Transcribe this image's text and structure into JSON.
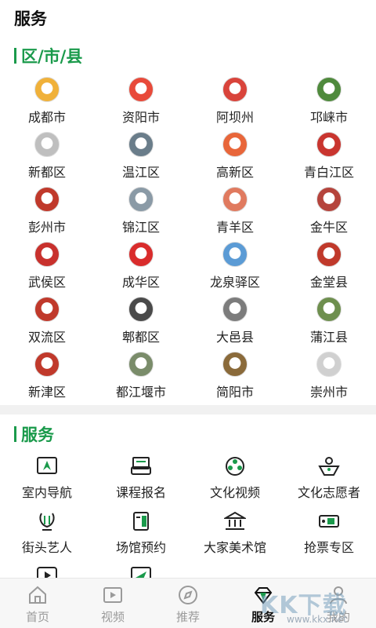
{
  "header": {
    "title": "服务"
  },
  "districts": {
    "heading": "区/市/县",
    "items": [
      {
        "label": "成都市",
        "color": "#f0b13a",
        "icon": "chengdu-emblem-icon"
      },
      {
        "label": "资阳市",
        "color": "#e84a3a",
        "icon": "ziyang-emblem-icon"
      },
      {
        "label": "阿坝州",
        "color": "#d9443b",
        "icon": "aba-emblem-icon"
      },
      {
        "label": "邛崃市",
        "color": "#4f8a3c",
        "icon": "qionglai-emblem-icon"
      },
      {
        "label": "新都区",
        "color": "#bfbfbf",
        "icon": "xindu-emblem-icon"
      },
      {
        "label": "温江区",
        "color": "#6a7d8a",
        "icon": "wenjiang-emblem-icon"
      },
      {
        "label": "高新区",
        "color": "#e8663a",
        "icon": "gaoxin-emblem-icon"
      },
      {
        "label": "青白江区",
        "color": "#c9352f",
        "icon": "qingbaijiang-emblem-icon"
      },
      {
        "label": "彭州市",
        "color": "#c0392b",
        "icon": "pengzhou-emblem-icon"
      },
      {
        "label": "锦江区",
        "color": "#8a9aa6",
        "icon": "jinjiang-emblem-icon"
      },
      {
        "label": "青羊区",
        "color": "#e07a5f",
        "icon": "qingyang-emblem-icon"
      },
      {
        "label": "金牛区",
        "color": "#b5443c",
        "icon": "jinniu-emblem-icon"
      },
      {
        "label": "武侯区",
        "color": "#c8312d",
        "icon": "wuhou-emblem-icon"
      },
      {
        "label": "成华区",
        "color": "#d92c2c",
        "icon": "chenghua-emblem-icon"
      },
      {
        "label": "龙泉驿区",
        "color": "#5b9bd5",
        "icon": "longquanyi-emblem-icon"
      },
      {
        "label": "金堂县",
        "color": "#c0392b",
        "icon": "jintang-emblem-icon"
      },
      {
        "label": "双流区",
        "color": "#c0392b",
        "icon": "shuangliu-emblem-icon"
      },
      {
        "label": "郫都区",
        "color": "#4a4a4a",
        "icon": "pidu-emblem-icon"
      },
      {
        "label": "大邑县",
        "color": "#7c7c7c",
        "icon": "dayi-emblem-icon"
      },
      {
        "label": "蒲江县",
        "color": "#6e8f4e",
        "icon": "pujiang-emblem-icon"
      },
      {
        "label": "新津区",
        "color": "#c0392b",
        "icon": "xinjin-emblem-icon"
      },
      {
        "label": "都江堰市",
        "color": "#7a8c6a",
        "icon": "dujiangyan-emblem-icon"
      },
      {
        "label": "简阳市",
        "color": "#8a6a3a",
        "icon": "jianyang-emblem-icon"
      },
      {
        "label": "崇州市",
        "color": "#d0d0d0",
        "icon": "chongzhou-emblem-icon"
      }
    ]
  },
  "services": {
    "heading": "服务",
    "items": [
      {
        "label": "室内导航",
        "icon": "map-navigation-icon"
      },
      {
        "label": "课程报名",
        "icon": "course-signup-icon"
      },
      {
        "label": "文化视频",
        "icon": "film-reel-icon"
      },
      {
        "label": "文化志愿者",
        "icon": "volunteer-icon"
      },
      {
        "label": "街头艺人",
        "icon": "lyre-icon"
      },
      {
        "label": "场馆预约",
        "icon": "venue-booking-icon"
      },
      {
        "label": "大家美术馆",
        "icon": "museum-icon"
      },
      {
        "label": "抢票专区",
        "icon": "ticket-icon"
      }
    ],
    "partial_icons": [
      "play-icon",
      "send-icon"
    ]
  },
  "tabbar": {
    "items": [
      {
        "label": "首页",
        "icon": "home-icon",
        "active": false
      },
      {
        "label": "视频",
        "icon": "video-icon",
        "active": false
      },
      {
        "label": "推荐",
        "icon": "compass-icon",
        "active": false
      },
      {
        "label": "服务",
        "icon": "diamond-icon",
        "active": true
      },
      {
        "label": "我的",
        "icon": "user-icon",
        "active": false
      }
    ]
  },
  "watermark": {
    "main": "KK下载",
    "url": "www.kkx.net"
  },
  "colors": {
    "accent": "#1a9a4b",
    "inactive": "#9a9a9a",
    "active": "#111111"
  }
}
